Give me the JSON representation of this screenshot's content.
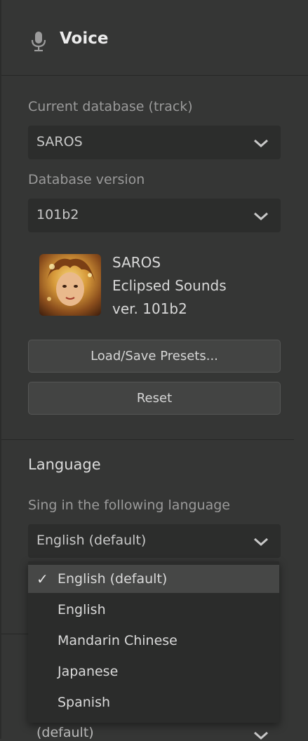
{
  "header": {
    "title": "Voice",
    "icon": "microphone-icon"
  },
  "voice": {
    "database_label": "Current database (track)",
    "database_value": "SAROS",
    "version_label": "Database version",
    "version_value": "101b2",
    "card": {
      "name": "SAROS",
      "vendor": "Eclipsed Sounds",
      "version": "ver. 101b2"
    },
    "load_save_button": "Load/Save Presets...",
    "reset_button": "Reset"
  },
  "language": {
    "title": "Language",
    "sing_label": "Sing in the following language",
    "selected": "English (default)",
    "options": [
      {
        "check": "✓",
        "label": "English (default)"
      },
      {
        "check": "",
        "label": "English"
      },
      {
        "check": "",
        "label": "Mandarin Chinese"
      },
      {
        "check": "",
        "label": "Japanese"
      },
      {
        "check": "",
        "label": "Spanish"
      }
    ],
    "hidden_select_value": "(default)"
  },
  "colors": {
    "background": "#353635",
    "field": "#2c2d2c",
    "button": "#434443",
    "menu": "#2b2c2b",
    "menu_selected": "#464746"
  }
}
